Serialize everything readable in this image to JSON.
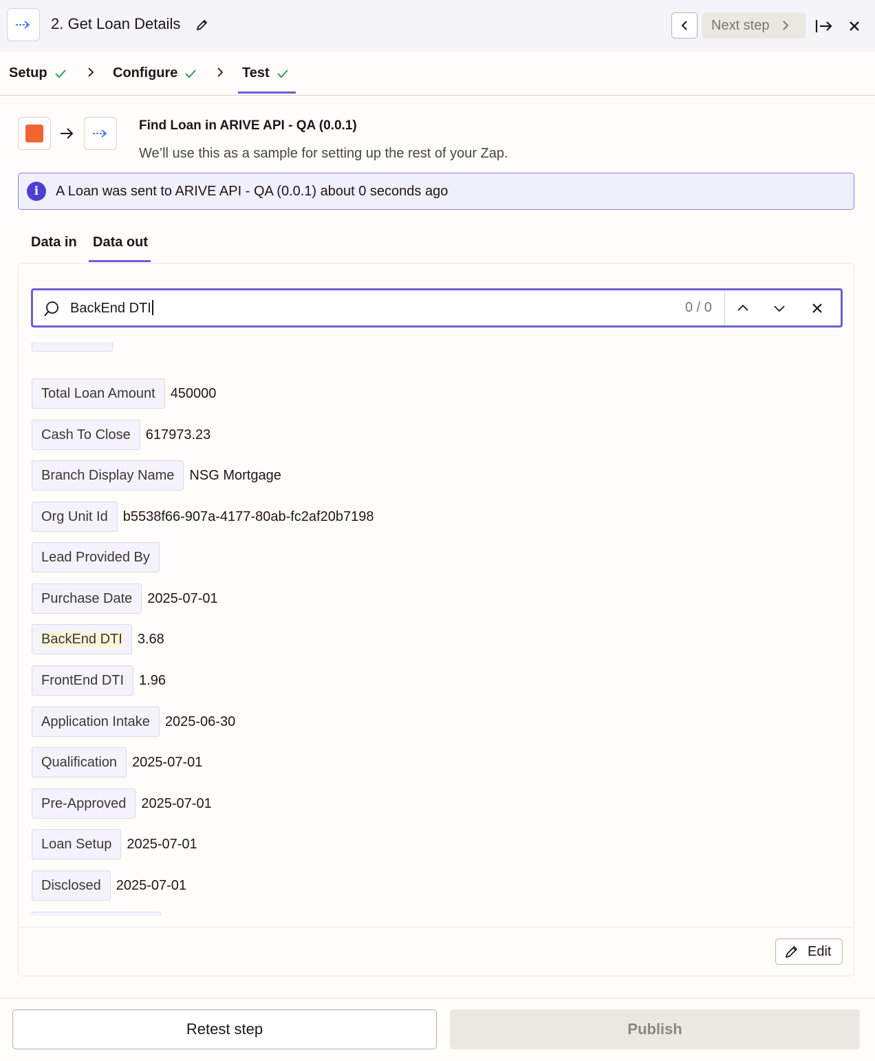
{
  "header": {
    "title": "2. Get Loan Details",
    "next_step_label": "Next step"
  },
  "steps": [
    {
      "label": "Setup"
    },
    {
      "label": "Configure"
    },
    {
      "label": "Test"
    }
  ],
  "sample": {
    "title": "Find Loan in ARIVE API - QA (0.0.1)",
    "subtitle": "We’ll use this as a sample for setting up the rest of your Zap."
  },
  "info": {
    "message": "A Loan was sent to ARIVE API - QA (0.0.1) about 0 seconds ago"
  },
  "data_tabs": {
    "data_in": "Data in",
    "data_out": "Data out",
    "active": "Data out"
  },
  "search": {
    "value": "BackEnd DTI",
    "count": "0 / 0"
  },
  "fields": [
    {
      "key": "Total Loan Amount",
      "value": "450000"
    },
    {
      "key": "Cash To Close",
      "value": "617973.23"
    },
    {
      "key": "Branch Display Name",
      "value": "NSG Mortgage"
    },
    {
      "key": "Org Unit Id",
      "value": "b5538f66-907a-4177-80ab-fc2af20b7198"
    },
    {
      "key": "Lead Provided By",
      "value": ""
    },
    {
      "key": "Purchase Date",
      "value": "2025-07-01"
    },
    {
      "key": "BackEnd DTI",
      "value": "3.68"
    },
    {
      "key": "FrontEnd DTI",
      "value": "1.96"
    },
    {
      "key": "Application Intake",
      "value": "2025-06-30"
    },
    {
      "key": "Qualification",
      "value": "2025-07-01"
    },
    {
      "key": "Pre-Approved",
      "value": "2025-07-01"
    },
    {
      "key": "Loan Setup",
      "value": "2025-07-01"
    },
    {
      "key": "Disclosed",
      "value": "2025-07-01"
    }
  ],
  "panel": {
    "edit_label": "Edit"
  },
  "footer": {
    "retest_label": "Retest step",
    "publish_label": "Publish"
  },
  "colors": {
    "accent": "#6a5fd5",
    "trigger_icon": "#f26430",
    "success_check": "#2e9e5b",
    "info_icon": "#4c3fd0"
  }
}
